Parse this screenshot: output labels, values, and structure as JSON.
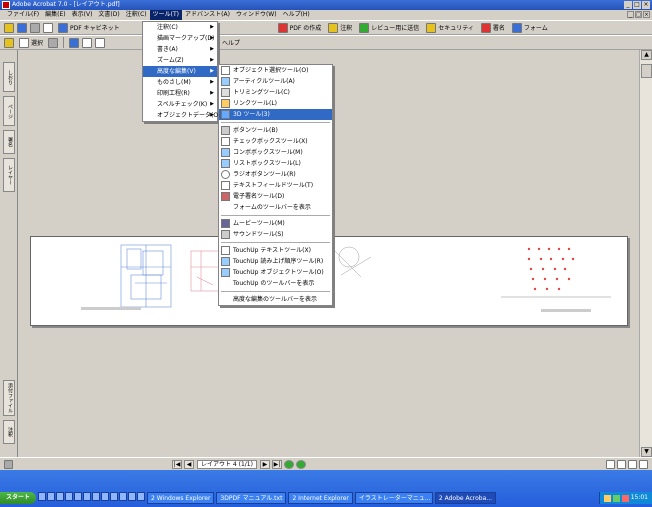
{
  "window": {
    "title": "Adobe Acrobat 7.0 - [レイアウト.pdf]",
    "controls": [
      "_",
      "□",
      "×"
    ]
  },
  "menubar": {
    "items": [
      "ファイル(F)",
      "編集(E)",
      "表示(V)",
      "文書(D)",
      "注釈(C)",
      "ツール(T)",
      "アドバンスト(A)",
      "ウィンドウ(W)",
      "ヘルプ(H)"
    ],
    "active_index": 5,
    "doc_controls": [
      "_",
      "□",
      "×"
    ]
  },
  "toolbar1": {
    "pdf_package": "PDF キャビネット",
    "create_pdf": "PDF の作成",
    "comment": "注釈",
    "review": "レビュー用に送信",
    "secure": "セキュリティ",
    "sign": "署名",
    "forms": "フォーム"
  },
  "toolbar2": {
    "select": "選択",
    "help": "ヘルプ"
  },
  "left_tabs": [
    "しおり",
    "ページ",
    "署名",
    "レイヤー"
  ],
  "left_tabs_bottom": [
    "添付ファイル",
    "注釈"
  ],
  "menu_tools": {
    "items": [
      {
        "label": "注釈(C)",
        "sub": true
      },
      {
        "label": "描画マークアップ(D)",
        "sub": true
      },
      {
        "label": "書き(A)",
        "sub": true
      },
      {
        "label": "ズーム(Z)",
        "sub": true
      },
      {
        "label": "高度な編集(V)",
        "sub": true
      },
      {
        "label": "ものさし(M)",
        "sub": true
      },
      {
        "label": "印刷工程(R)",
        "sub": true
      },
      {
        "label": "スペルチェック(K)",
        "sub": true
      },
      {
        "label": "オブジェクトデータ(O)",
        "sub": true
      }
    ],
    "highlight_index": 4
  },
  "menu_advanced_editing": {
    "items": [
      {
        "label": "オブジェクト選択ツール(O)"
      },
      {
        "label": "アーティクルツール(A)"
      },
      {
        "label": "トリミングツール(C)"
      },
      {
        "label": "リンクツール(L)"
      },
      {
        "label": "3D ツール(3)"
      },
      {
        "sep": true
      },
      {
        "label": "ボタンツール(B)"
      },
      {
        "label": "チェックボックスツール(X)"
      },
      {
        "label": "コンボボックスツール(M)"
      },
      {
        "label": "リストボックスツール(L)"
      },
      {
        "label": "ラジオボタンツール(R)"
      },
      {
        "label": "テキストフィールドツール(T)"
      },
      {
        "label": "電子署名ツール(D)"
      },
      {
        "label": "フォームのツールバーを表示"
      },
      {
        "sep": true
      },
      {
        "label": "ムービーツール(M)"
      },
      {
        "label": "サウンドツール(S)"
      },
      {
        "sep": true
      },
      {
        "label": "TouchUp テキストツール(X)"
      },
      {
        "label": "TouchUp 読み上げ順序ツール(R)"
      },
      {
        "label": "TouchUp オブジェクトツール(O)"
      },
      {
        "label": "TouchUp のツールバーを表示"
      },
      {
        "sep": true
      },
      {
        "label": "高度な編集のツールバーを表示"
      }
    ],
    "highlight_index": 4
  },
  "status": {
    "page": "レイアウト 4 (1/1)"
  },
  "taskbar": {
    "start": "スタート",
    "tasks": [
      "2 Windows Explorer",
      "3DPDF マニュアル.txt",
      "2 Internet Explorer",
      "イラストレーターマニュ...",
      "2 Adobe Acroba..."
    ],
    "active_index": 4,
    "clock": "15:01"
  }
}
